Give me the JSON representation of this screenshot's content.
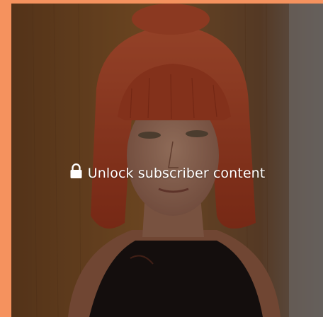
{
  "card": {
    "photo_description_icon": "portrait-photo",
    "overlay": {
      "icon": "lock-icon",
      "label": "Unlock subscriber content"
    }
  },
  "colors": {
    "page_background": "#f5925e",
    "overlay_text": "#ffffff"
  }
}
